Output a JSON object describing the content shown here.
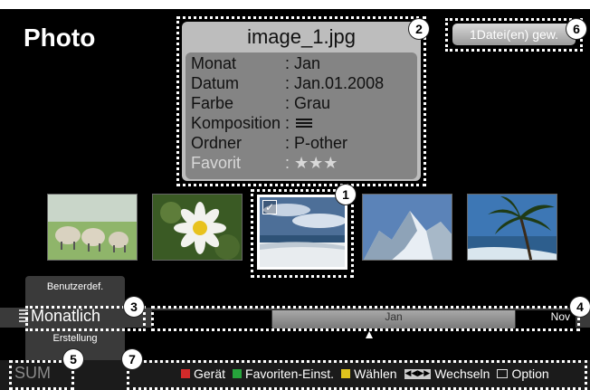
{
  "app": {
    "title": "Photo"
  },
  "info": {
    "filename": "image_1.jpg",
    "rows": [
      {
        "key": "Monat",
        "value": ": Jan"
      },
      {
        "key": "Datum",
        "value": ": Jan.01.2008"
      },
      {
        "key": "Farbe",
        "value": ": Grau"
      },
      {
        "key": "Komposition",
        "value": ":"
      },
      {
        "key": "Ordner",
        "value": ": P-other"
      },
      {
        "key": "Favorit",
        "value": ": ★★★"
      }
    ]
  },
  "selection": {
    "count_label": "1Datei(en) gew."
  },
  "thumbnails": [
    {
      "icon": "sheep-photo-icon"
    },
    {
      "icon": "flower-photo-icon"
    },
    {
      "icon": "beach-photo-icon",
      "selected": true
    },
    {
      "icon": "mountain-photo-icon"
    },
    {
      "icon": "palm-photo-icon"
    }
  ],
  "view": {
    "top": "Benutzerdef.",
    "current": "Monatlich",
    "bottom": "Erstellung"
  },
  "timeline": {
    "current": "Jan",
    "next": "Nov"
  },
  "footer": {
    "sum": "SUM",
    "help": [
      {
        "label": "Gerät",
        "color": "#d42a2a"
      },
      {
        "label": "Favoriten-Einst.",
        "color": "#26a33b"
      },
      {
        "label": "Wählen",
        "color": "#e0c41d"
      },
      {
        "label": "Wechseln",
        "icon": "rewind-ff-icon"
      },
      {
        "label": "Option",
        "icon": "option-icon"
      }
    ]
  },
  "callouts": [
    "1",
    "2",
    "3",
    "4",
    "5",
    "6",
    "7"
  ]
}
